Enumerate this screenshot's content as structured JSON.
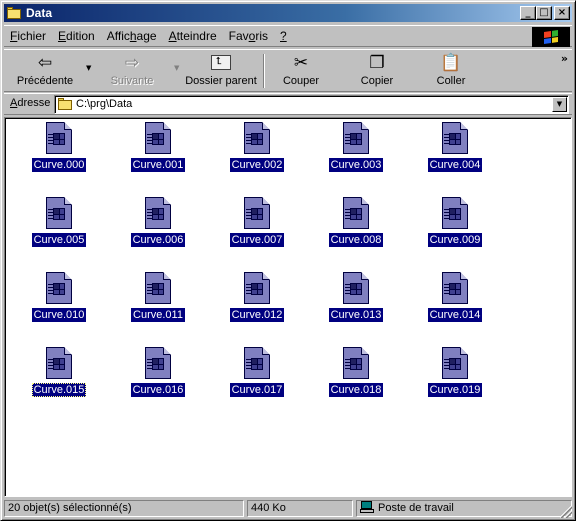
{
  "window": {
    "title": "Data"
  },
  "menu": {
    "items": [
      {
        "pre": "",
        "u": "F",
        "post": "ichier"
      },
      {
        "pre": "",
        "u": "E",
        "post": "dition"
      },
      {
        "pre": "Affic",
        "u": "h",
        "post": "age"
      },
      {
        "pre": "",
        "u": "A",
        "post": "tteindre"
      },
      {
        "pre": "Fav",
        "u": "o",
        "post": "ris"
      },
      {
        "pre": "",
        "u": "?",
        "post": ""
      }
    ]
  },
  "toolbar": {
    "back_label": "Précédente",
    "forward_label": "Suivante",
    "up_label": "Dossier parent",
    "cut_label": "Couper",
    "copy_label": "Copier",
    "paste_label": "Coller",
    "overflow": "»"
  },
  "address": {
    "label_u": "A",
    "label_rest": "dresse",
    "value": "C:\\prg\\Data"
  },
  "files": [
    "Curve.000",
    "Curve.001",
    "Curve.002",
    "Curve.003",
    "Curve.004",
    "Curve.005",
    "Curve.006",
    "Curve.007",
    "Curve.008",
    "Curve.009",
    "Curve.010",
    "Curve.011",
    "Curve.012",
    "Curve.013",
    "Curve.014",
    "Curve.015",
    "Curve.016",
    "Curve.017",
    "Curve.018",
    "Curve.019"
  ],
  "focused_file": "Curve.015",
  "statusbar": {
    "selection": "20 objet(s) sélectionné(s)",
    "size": "440 Ko",
    "zone": "Poste de travail"
  },
  "colors": {
    "title_gradient_start": "#0a246a",
    "selection": "#000080",
    "chrome": "#c0c0c0"
  }
}
